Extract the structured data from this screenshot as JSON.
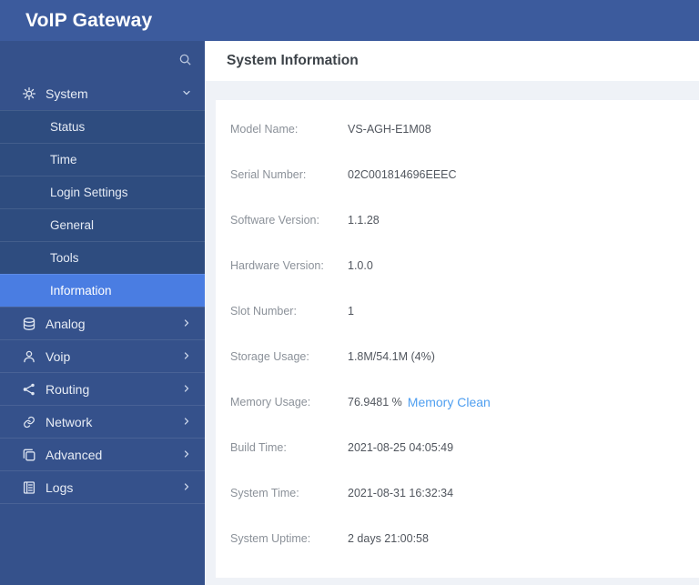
{
  "app": {
    "title": "VoIP Gateway"
  },
  "colors": {
    "header_bg": "#3c5b9d",
    "sidebar_bg": "#35518b",
    "submenu_bg": "#2e4c7f",
    "active_item_bg": "#4a7de2",
    "link_blue": "#4f9ff0",
    "content_bg": "#eff2f7"
  },
  "sidebar": {
    "search_icon": "search-icon",
    "system": {
      "label": "System",
      "icon": "gear-icon",
      "state": "expanded"
    },
    "system_children": [
      {
        "label": "Status",
        "active": false
      },
      {
        "label": "Time",
        "active": false
      },
      {
        "label": "Login Settings",
        "active": false
      },
      {
        "label": "General",
        "active": false
      },
      {
        "label": "Tools",
        "active": false
      },
      {
        "label": "Information",
        "active": true
      }
    ],
    "items": [
      {
        "label": "Analog",
        "icon": "database-icon"
      },
      {
        "label": "Voip",
        "icon": "user-icon"
      },
      {
        "label": "Routing",
        "icon": "share-icon"
      },
      {
        "label": "Network",
        "icon": "link-icon"
      },
      {
        "label": "Advanced",
        "icon": "copy-icon"
      },
      {
        "label": "Logs",
        "icon": "log-icon"
      }
    ]
  },
  "main": {
    "title": "System Information",
    "fields": [
      {
        "label": "Model Name:",
        "value": "VS-AGH-E1M08"
      },
      {
        "label": "Serial Number:",
        "value": "02C001814696EEEC"
      },
      {
        "label": "Software Version:",
        "value": "1.1.28"
      },
      {
        "label": "Hardware Version:",
        "value": "1.0.0"
      },
      {
        "label": "Slot Number:",
        "value": "1"
      },
      {
        "label": "Storage Usage:",
        "value": "1.8M/54.1M (4%)"
      },
      {
        "label": "Memory Usage:",
        "value": "76.9481 %",
        "link": "Memory Clean"
      },
      {
        "label": "Build Time:",
        "value": "2021-08-25 04:05:49"
      },
      {
        "label": "System Time:",
        "value": "2021-08-31 16:32:34"
      },
      {
        "label": "System Uptime:",
        "value": "2 days 21:00:58"
      }
    ]
  }
}
